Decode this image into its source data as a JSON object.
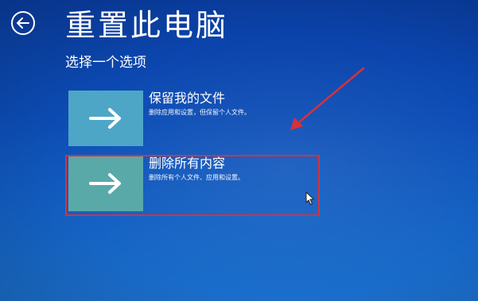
{
  "header": {
    "title": "重置此电脑",
    "subtitle": "选择一个选项"
  },
  "options": [
    {
      "title": "保留我的文件",
      "description": "删除应用和设置，但保留个人文件。",
      "icon": "arrow-right-icon"
    },
    {
      "title": "删除所有内容",
      "description": "删除所有个人文件、应用和设置。",
      "icon": "arrow-right-icon"
    }
  ],
  "colors": {
    "background": "#0c4db6",
    "tile_primary": "#4ea6c6",
    "tile_highlight": "#5aa9a9",
    "annotation": "#d9303a"
  }
}
